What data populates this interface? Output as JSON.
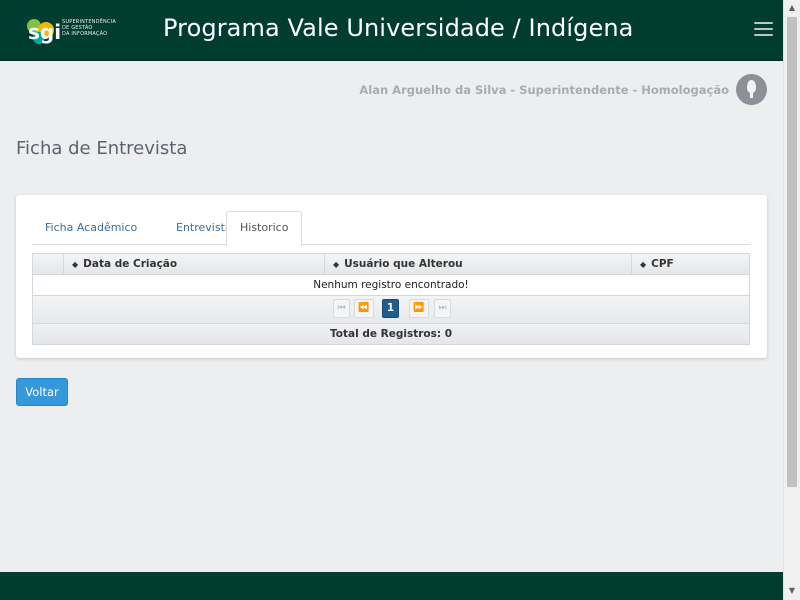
{
  "header": {
    "title": "Programa Vale Universidade / Indígena",
    "logo": {
      "mark_text": "sgi",
      "caption_lines": [
        "SUPERINTENDÊNCIA",
        "DE GESTÃO",
        "DA INFORMAÇÃO"
      ]
    },
    "menu_icon": "hamburger-icon"
  },
  "user": {
    "label": "Alan Arguelho da Silva - Superintendente - Homologação",
    "avatar_icon": "user-avatar-icon"
  },
  "page": {
    "title": "Ficha de Entrevista"
  },
  "tabs": [
    {
      "label": "Ficha Acadêmico",
      "active": false
    },
    {
      "label": "Entrevista",
      "active": false
    },
    {
      "label": "Historico",
      "active": true
    }
  ],
  "table": {
    "columns": [
      "Data de Criação",
      "Usuário que Alterou",
      "CPF"
    ],
    "empty_message": "Nenhum registro encontrado!",
    "pagination": {
      "current_page": "1",
      "first_icon": "first-page-icon",
      "prev_icon": "prev-page-icon",
      "next_icon": "next-page-icon",
      "last_icon": "last-page-icon"
    },
    "total_label": "Total de Registros: 0"
  },
  "actions": {
    "back_label": "Voltar"
  },
  "colors": {
    "header_bg": "#003d30",
    "primary_button": "#3498db",
    "active_page": "#1f5d8c",
    "page_bg": "#eceef0"
  }
}
